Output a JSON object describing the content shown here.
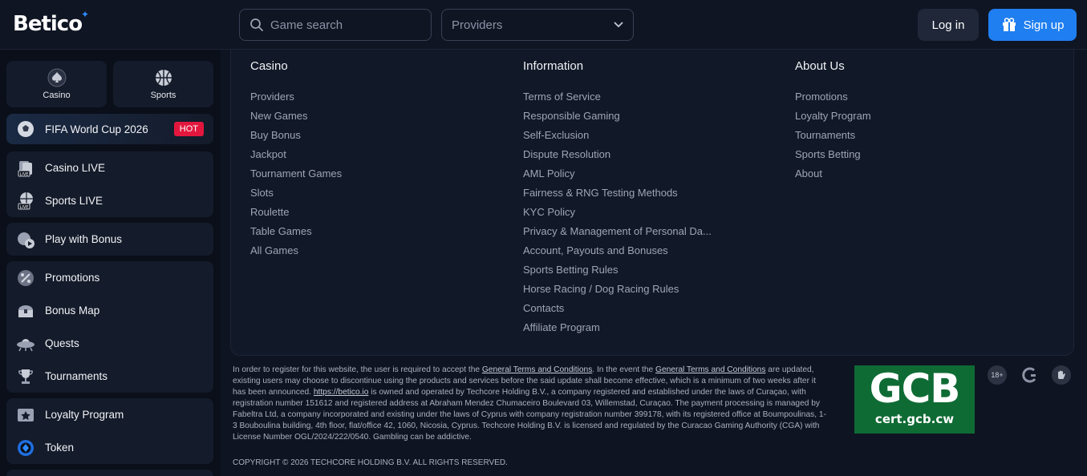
{
  "header": {
    "logo": "Betico",
    "search_placeholder": "Game search",
    "providers_label": "Providers",
    "login": "Log in",
    "signup": "Sign up"
  },
  "sidebar": {
    "top": [
      {
        "label": "Casino",
        "icon": "spade-icon"
      },
      {
        "label": "Sports",
        "icon": "basketball-icon"
      }
    ],
    "fifa": {
      "label": "FIFA World Cup 2026",
      "badge": "HOT"
    },
    "live": [
      {
        "label": "Casino LIVE"
      },
      {
        "label": "Sports LIVE"
      }
    ],
    "bonus": {
      "label": "Play with Bonus"
    },
    "promo": [
      {
        "label": "Promotions"
      },
      {
        "label": "Bonus Map"
      },
      {
        "label": "Quests"
      },
      {
        "label": "Tournaments"
      }
    ],
    "loyalty": [
      {
        "label": "Loyalty Program"
      },
      {
        "label": "Token"
      }
    ]
  },
  "footer": {
    "casino": {
      "title": "Casino",
      "links": [
        "Providers",
        "New Games",
        "Buy Bonus",
        "Jackpot",
        "Tournament Games",
        "Slots",
        "Roulette",
        "Table Games",
        "All Games"
      ]
    },
    "information": {
      "title": "Information",
      "links": [
        "Terms of Service",
        "Responsible Gaming",
        "Self-Exclusion",
        "Dispute Resolution",
        "AML Policy",
        "Fairness & RNG Testing Methods",
        "KYC Policy",
        "Privacy & Management of Personal Da...",
        "Account, Payouts and Bonuses",
        "Sports Betting Rules",
        "Horse Racing / Dog Racing Rules",
        "Contacts",
        "Affiliate Program"
      ]
    },
    "about": {
      "title": "About Us",
      "links": [
        "Promotions",
        "Loyalty Program",
        "Tournaments",
        "Sports Betting",
        "About"
      ]
    }
  },
  "legal": {
    "p1": "In order to register for this website, the user is required to accept the ",
    "gtc": "General Terms and Conditions",
    "p2": ". In the event the ",
    "p3": " are updated, existing users may choose to discontinue using the products and services before the said update shall become effective, which is a minimum of two weeks after it has been announced. ",
    "url": "https://betico.io",
    "p4": " is owned and operated by Techcore Holding B.V., a company registered and established under the laws of Curaçao, with registration number 151612 and registered address at Abraham Mendez Chumaceiro Boulevard 03, Willemstad, Curaçao. The payment processing is managed by Fabeltra Ltd, a company incorporated and existing under the laws of Cyprus with company registration number 399178, with its registered office at Boumpoulinas, 1-3 Bouboulina building, 4th floor, flat/office 42, 1060, Nicosia, Cyprus. Techcore Holding B.V. is licensed and regulated by the Curacao Gaming Authority (CGA) with License Number OGL/2024/222/0540. Gambling can be addictive.",
    "copyright": "COPYRIGHT © 2026 TECHCORE HOLDING B.V. ALL RIGHTS RESERVED."
  },
  "badges": {
    "gcb": "GCB",
    "gcb_url": "cert.gcb.cw",
    "age": "18+"
  }
}
